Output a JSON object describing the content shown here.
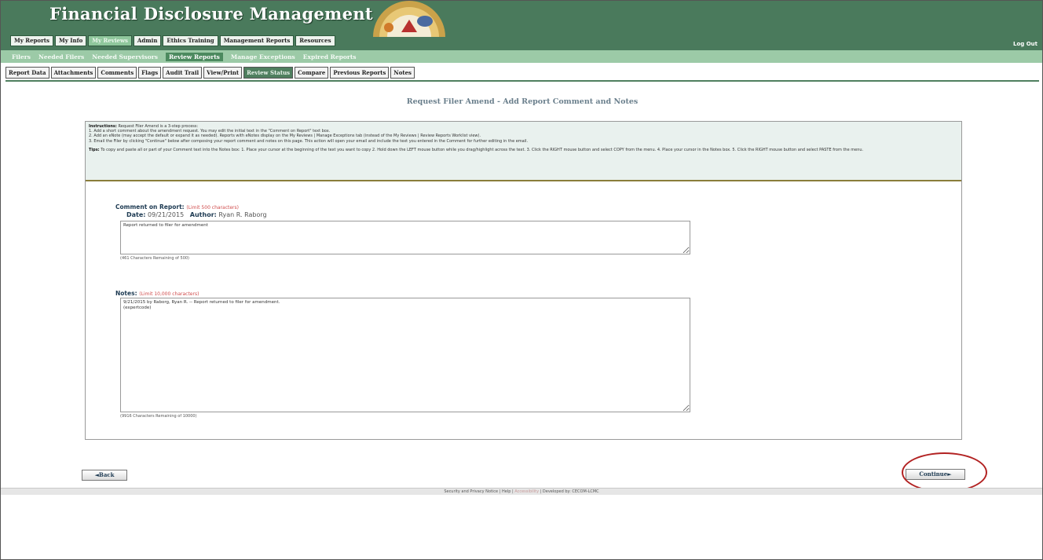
{
  "header": {
    "title": "Financial Disclosure Management",
    "logout": "Log Out"
  },
  "main_tabs": [
    {
      "label": "My Reports"
    },
    {
      "label": "My Info"
    },
    {
      "label": "My Reviews"
    },
    {
      "label": "Admin"
    },
    {
      "label": "Ethics Training"
    },
    {
      "label": "Management Reports"
    },
    {
      "label": "Resources"
    }
  ],
  "sub_nav": [
    {
      "label": "Filers"
    },
    {
      "label": "Needed Filers"
    },
    {
      "label": "Needed Supervisors"
    },
    {
      "label": "Review Reports"
    },
    {
      "label": "Manage Exceptions"
    },
    {
      "label": "Expired Reports"
    }
  ],
  "report_tabs": [
    {
      "label": "Report Data"
    },
    {
      "label": "Attachments"
    },
    {
      "label": "Comments"
    },
    {
      "label": "Flags"
    },
    {
      "label": "Audit Trail"
    },
    {
      "label": "View/Print"
    },
    {
      "label": "Review Status"
    },
    {
      "label": "Compare"
    },
    {
      "label": "Previous Reports"
    },
    {
      "label": "Notes"
    }
  ],
  "page_heading": "Request Filer Amend - Add Report Comment and Notes",
  "instructions": {
    "label": "Instructions:",
    "intro": "Request Filer Amend is a 3-step process:",
    "line1": "1. Add a short comment about the amendment request. You may edit the initial text in the \"Comment on Report\" text box.",
    "line2": "2. Add an eNote (may accept the default or expand it as needed). Reports with eNotes display on the My Reviews | Manage Exceptions tab (instead of the My Reviews | Review Reports Worklist view).",
    "line3": "3. Email the Filer by clicking \"Continue\" below after composing your report comment and notes on this page. This action will open your email and include the text you entered in the Comment for further editing in the email.",
    "tips_label": "Tips:",
    "tips": "To copy and paste all or part of your Comment text into the Notes box: 1. Place your cursor at the beginning of the text you want to copy 2. Hold down the LEFT mouse button while you drag/highlight across the text. 3. Click the RIGHT mouse button and select COPY from the menu. 4. Place your cursor in the Notes box. 5. Click the RIGHT mouse button and select PASTE from the menu."
  },
  "comment": {
    "label": "Comment on Report:",
    "limit": "(Limit 500 characters)",
    "date_label": "Date:",
    "date": "09/21/2015",
    "author_label": "Author:",
    "author": "Ryan R. Raborg",
    "value": "Report returned to filer for amendment",
    "remaining": "(461 Characters Remaining of 500)"
  },
  "notes": {
    "label": "Notes:",
    "limit": "(Limit 10,000 characters)",
    "value": "9/21/2015 by Raborg, Ryan R. -- Report returned to filer for amendment.\n(expertcode)",
    "remaining": "(9916 Characters Remaining of 10000)"
  },
  "buttons": {
    "back": "◄Back",
    "continue": "Continue►"
  },
  "footer": {
    "security": "Security and Privacy Notice",
    "sep1": " | ",
    "help": "Help",
    "sep2": " | ",
    "accessibility": "Accessibility",
    "sep3": " | ",
    "developed": "Developed by: CECOM-LCMC"
  },
  "colors": {
    "header_green": "#4a7a5c",
    "subnav_green": "#9ccaa7",
    "active_tab": "#4f7f5f",
    "highlight_red": "#b22222",
    "instructions_bg": "#e9f1ee"
  }
}
